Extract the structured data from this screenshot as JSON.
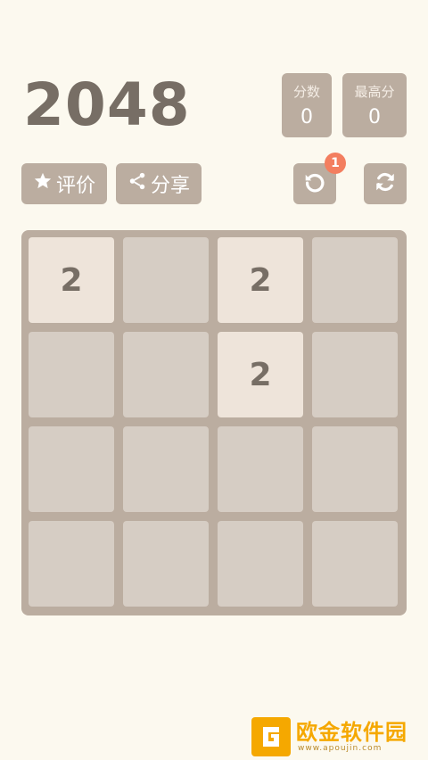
{
  "app": {
    "title": "2048"
  },
  "scores": {
    "score_label": "分数",
    "score_value": "0",
    "best_label": "最高分",
    "best_value": "0"
  },
  "buttons": {
    "rate_label": "评价",
    "share_label": "分享",
    "undo_badge": "1"
  },
  "board": {
    "rows": [
      [
        "2",
        "",
        "2",
        ""
      ],
      [
        "",
        "",
        "2",
        ""
      ],
      [
        "",
        "",
        "",
        ""
      ],
      [
        "",
        "",
        "",
        ""
      ]
    ]
  },
  "watermark": {
    "name": "欧金软件园",
    "url": "www.apoujin.com"
  },
  "colors": {
    "background": "#fcf9ef",
    "board": "#bbada0",
    "empty_cell": "#d6cdc4",
    "tile_2": "#eee4da",
    "text_dark": "#776e65",
    "badge": "#f37e5f",
    "watermark": "#f5a800"
  }
}
